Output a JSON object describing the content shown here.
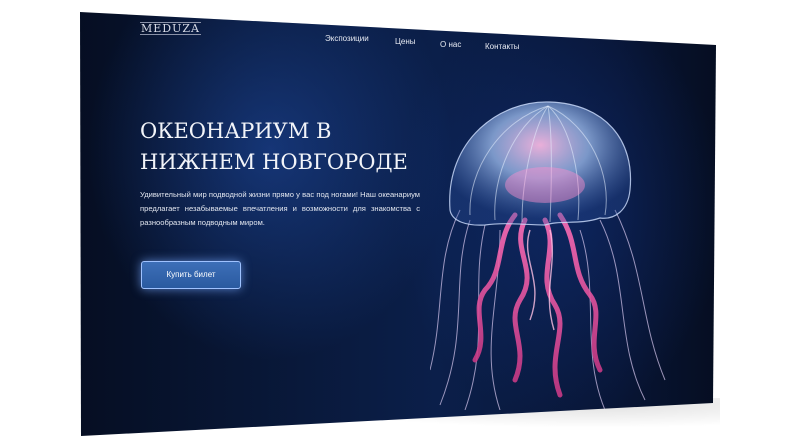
{
  "site": {
    "logo": "MEDUZA"
  },
  "nav": {
    "items": [
      "Экспозиции",
      "Цены",
      "О нас",
      "Контакты"
    ]
  },
  "hero": {
    "title": "ОКЕОНАРИУМ В НИЖНЕМ НОВГОРОДЕ",
    "description": "Удивительный мир подводной жизни прямо у вас под ногами! Наш океанариум предлагает незабываемые впечатления и возможности для знакомства с разнообразным подводным миром.",
    "cta_label": "Купить билет"
  },
  "colors": {
    "background": "#0b1f4a",
    "button": "#2f63ab",
    "jelly_bell": "#7fa6e0",
    "jelly_pink": "#e84d9a"
  },
  "icons": {
    "hero_image": "jellyfish-illustration"
  }
}
